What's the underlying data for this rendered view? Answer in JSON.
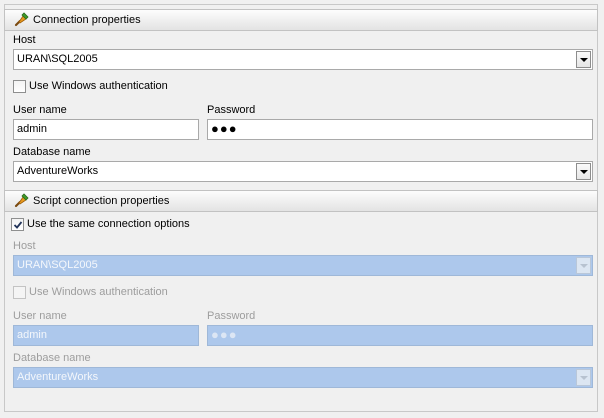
{
  "connection": {
    "header": "Connection properties",
    "icon": "connection-plug-icon",
    "host_label": "Host",
    "host_value": "URAN\\SQL2005",
    "windows_auth_label": "Use Windows authentication",
    "windows_auth_checked": false,
    "username_label": "User name",
    "username_value": "admin",
    "password_label": "Password",
    "password_value": "●●●",
    "database_label": "Database name",
    "database_value": "AdventureWorks"
  },
  "script": {
    "header": "Script connection properties",
    "icon": "connection-plug-icon",
    "same_connection_label": "Use the same connection options",
    "same_connection_checked": true,
    "host_label": "Host",
    "host_value": "URAN\\SQL2005",
    "windows_auth_label": "Use Windows authentication",
    "windows_auth_checked": false,
    "username_label": "User name",
    "username_value": "admin",
    "password_label": "Password",
    "password_value": "●●●",
    "database_label": "Database name",
    "database_value": "AdventureWorks"
  },
  "colors": {
    "disabled_field": "#adc8ec",
    "disabled_text": "#9d9d9d",
    "header_border": "#c2c2c2"
  }
}
